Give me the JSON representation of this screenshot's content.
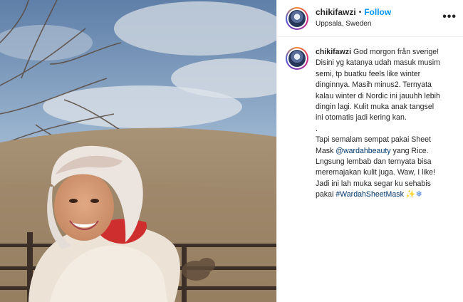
{
  "post": {
    "username": "chikifawzi",
    "separator": "•",
    "follow_label": "Follow",
    "location": "Uppsala, Sweden",
    "more_label": "•••"
  },
  "caption": {
    "username": "chikifawzi",
    "line1_text": "God morgon från sverige!",
    "lines_a": [
      "Disini yg katanya udah masuk musim",
      "semi, tp buatku feels like winter",
      "dinginnya. Masih minus2. Ternyata",
      "kalau winter di Nordic ini jauuhh lebih",
      "dingin lagi. Kulit muka anak tangsel",
      "ini otomatis jadi kering kan.",
      "."
    ],
    "line_b1": "Tapi semalam sempat pakai Sheet",
    "line_b2_prefix": "Mask ",
    "mention": "@wardahbeauty",
    "line_b2_suffix": " yang Rice.",
    "lines_c": [
      "Lngsung lembab dan ternyata bisa",
      "meremajakan kulit juga. Waw, I like!",
      "Jadi ini lah muka segar ku sehabis"
    ],
    "last_prefix": "pakai ",
    "hashtag": "#WardahSheetMask",
    "emoji_1": "✨",
    "emoji_2": "❄"
  },
  "colors": {
    "link_blue": "#0095f6",
    "mention_blue": "#00376b",
    "text": "#262626",
    "divider": "#efefef"
  },
  "icons": {
    "more": "more-options-icon",
    "sparkles": "sparkles-emoji",
    "snowflake": "snowflake-emoji"
  }
}
